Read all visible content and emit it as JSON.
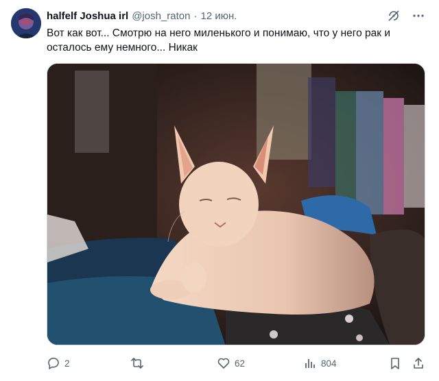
{
  "tweet": {
    "author_name": "halfelf Joshua irl",
    "handle": "@josh_raton",
    "separator": "·",
    "date": "12 июн.",
    "text": "Вот как вот... Смотрю на него миленького и понимаю, что у него рак и осталось ему немного... Никак"
  },
  "header_icons": [
    "grok-icon",
    "more-options-icon"
  ],
  "actions": {
    "replies": "2",
    "retweets": "",
    "likes": "62",
    "views": "804"
  },
  "colors": {
    "text": "#0f1419",
    "secondary": "#536471",
    "border": "#cfd9de"
  }
}
